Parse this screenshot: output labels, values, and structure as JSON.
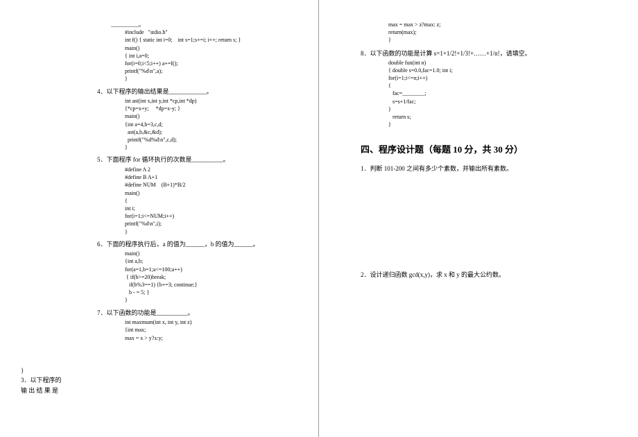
{
  "left": {
    "side_note_l1": "}",
    "side_note_l2": "3．以下程序的",
    "side_note_l3": "输 出 结 果 是",
    "top_blank": "__________。",
    "code3": [
      "#include   \"stdio.h\"",
      "int f() { static int i=0;    int s=1;s+=i; i++; return s; }",
      "main()",
      "{ int i,a=0;",
      "for(i=0;i<5;i++) a+=f();",
      "printf(\"%d\\n\",a);",
      "}"
    ],
    "q4": "4．以下程序的输出结果是____________。",
    "code4": [
      "int ast(int x,int y,int *cp,int *dp)",
      "{*cp=x+y;     *dp=x-y; }",
      "main()",
      "{int a=4,b=3,c,d;",
      "  ast(a,b,&c,&d);",
      "  printf(\"%d%d\\n\",c,d);",
      "}"
    ],
    "q5": "5．下面程序 for 循环执行的次数是__________。",
    "code5": [
      "#define A 2",
      "#define B A+1",
      "#define NUM    (B+1)*B/2",
      "main()",
      "{",
      "int i;",
      "for(i=1;i<=NUM;i++)",
      "printf(\"%d\\n\",i);",
      "}"
    ],
    "q6": "6．下面的程序执行后，a 的值为______，b 的值为______。",
    "code6": [
      "main()",
      "{int a,b;",
      "for(a=1,b=1;a<=100;a++)",
      " { if(b>=20)break;",
      "   if(b%3==1) {b+=3; continue;}",
      "   b - = 5; }",
      "}"
    ],
    "q7": "7．以下函数的功能是__________。",
    "code7": [
      "int maxmum(int x, int y, int z)",
      "{int max;",
      "max = x > y?x:y;"
    ]
  },
  "right": {
    "code7b": [
      "max = max > z?max: z;",
      "return(max);",
      "}"
    ],
    "q8": "8．以下函数的功能是计算 s=1+1/2!+1/3!+……+1/n!，请填空。",
    "code8": [
      "double fun(int n)",
      "{ double s=0.0,fac=1.0; int i;",
      "for(i=1;i<=n;i++)",
      "{",
      "   fac=________;",
      "   s=s+1/fac;",
      "}",
      "   return s;",
      "}"
    ],
    "section4_title": "四、程序设计题（每题 10 分，共 30 分）",
    "q4_1": "1．判断 101-200 之间有多少个素数，并输出所有素数。",
    "q4_2": "2．设计递归函数 gcd(x,y)，求 x 和 y 的最大公约数。"
  }
}
